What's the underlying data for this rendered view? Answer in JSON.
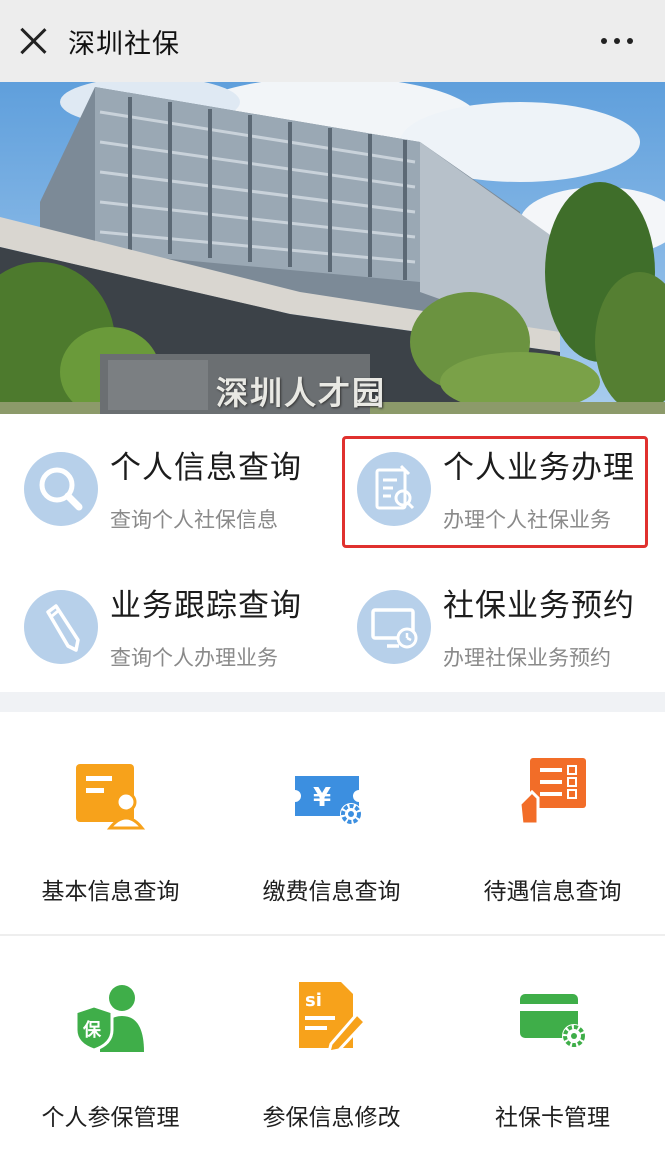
{
  "header": {
    "title": "深圳社保"
  },
  "banner": {
    "sign_text": "深圳人才园"
  },
  "quick_services": [
    {
      "title": "个人信息查询",
      "subtitle": "查询个人社保信息",
      "icon": "magnifier-icon"
    },
    {
      "title": "个人业务办理",
      "subtitle": "办理个人社保业务",
      "icon": "document-edit-icon",
      "highlighted": true
    },
    {
      "title": "业务跟踪查询",
      "subtitle": "查询个人办理业务",
      "icon": "pencil-icon"
    },
    {
      "title": "社保业务预约",
      "subtitle": "办理社保业务预约",
      "icon": "monitor-clock-icon"
    }
  ],
  "grid_services": [
    {
      "label": "基本信息查询",
      "icon": "profile-card-icon",
      "color": "#f7a21b"
    },
    {
      "label": "缴费信息查询",
      "icon": "yuan-ticket-icon",
      "color": "#3c8fe0"
    },
    {
      "label": "待遇信息查询",
      "icon": "checklist-hand-icon",
      "color": "#f26d28"
    },
    {
      "label": "个人参保管理",
      "icon": "insured-person-icon",
      "color": "#3fae49"
    },
    {
      "label": "参保信息修改",
      "icon": "si-document-pen-icon",
      "color": "#f7a21b"
    },
    {
      "label": "社保卡管理",
      "icon": "card-gear-icon",
      "color": "#3fae49"
    }
  ],
  "colors": {
    "highlight_border": "#e0312e",
    "icon_circle": "#b7d0ea",
    "topbar_bg": "#ededed"
  }
}
